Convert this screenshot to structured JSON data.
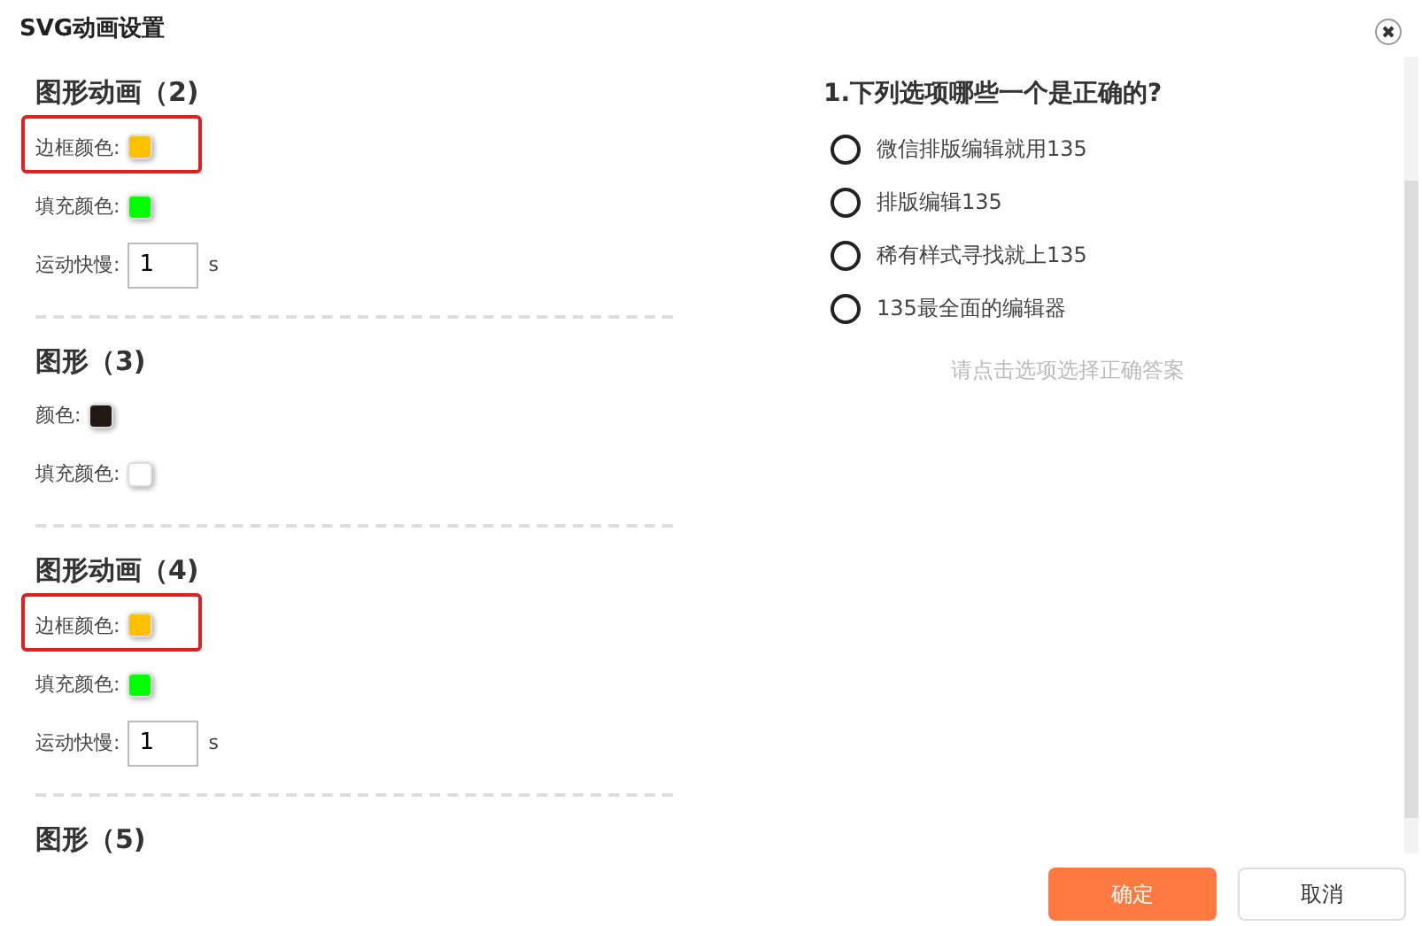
{
  "window": {
    "title": "SVG动画设置"
  },
  "sections": [
    {
      "heading": "图形动画（2)",
      "rows": [
        {
          "kind": "color",
          "label": "边框颜色:",
          "color": "#ffc000",
          "highlighted": true
        },
        {
          "kind": "color",
          "label": "填充颜色:",
          "color": "#00ff00",
          "highlighted": false
        },
        {
          "kind": "speed",
          "label": "运动快慢:",
          "value": "1",
          "unit": "s",
          "highlighted": false
        }
      ]
    },
    {
      "heading": "图形（3)",
      "rows": [
        {
          "kind": "color",
          "label": "颜色:",
          "color": "#231815",
          "highlighted": false
        },
        {
          "kind": "color",
          "label": "填充颜色:",
          "color": "#ffffff",
          "highlighted": false
        }
      ]
    },
    {
      "heading": "图形动画（4)",
      "rows": [
        {
          "kind": "color",
          "label": "边框颜色:",
          "color": "#ffc000",
          "highlighted": true
        },
        {
          "kind": "color",
          "label": "填充颜色:",
          "color": "#00ff00",
          "highlighted": false
        },
        {
          "kind": "speed",
          "label": "运动快慢:",
          "value": "1",
          "unit": "s",
          "highlighted": false
        }
      ]
    },
    {
      "heading": "图形（5)"
    }
  ],
  "question": {
    "title": "1.下列选项哪些一个是正确的?",
    "options": [
      {
        "label": "微信排版编辑就用135",
        "selected": false
      },
      {
        "label": "排版编辑135",
        "selected": false
      },
      {
        "label": "稀有样式寻找就上135",
        "selected": false
      },
      {
        "label": "135最全面的编辑器",
        "selected": false
      }
    ],
    "hint": "请点击选项选择正确答案"
  },
  "buttons": [
    {
      "label": "确定",
      "kind": "primary"
    },
    {
      "label": "取消",
      "kind": "secondary"
    }
  ]
}
